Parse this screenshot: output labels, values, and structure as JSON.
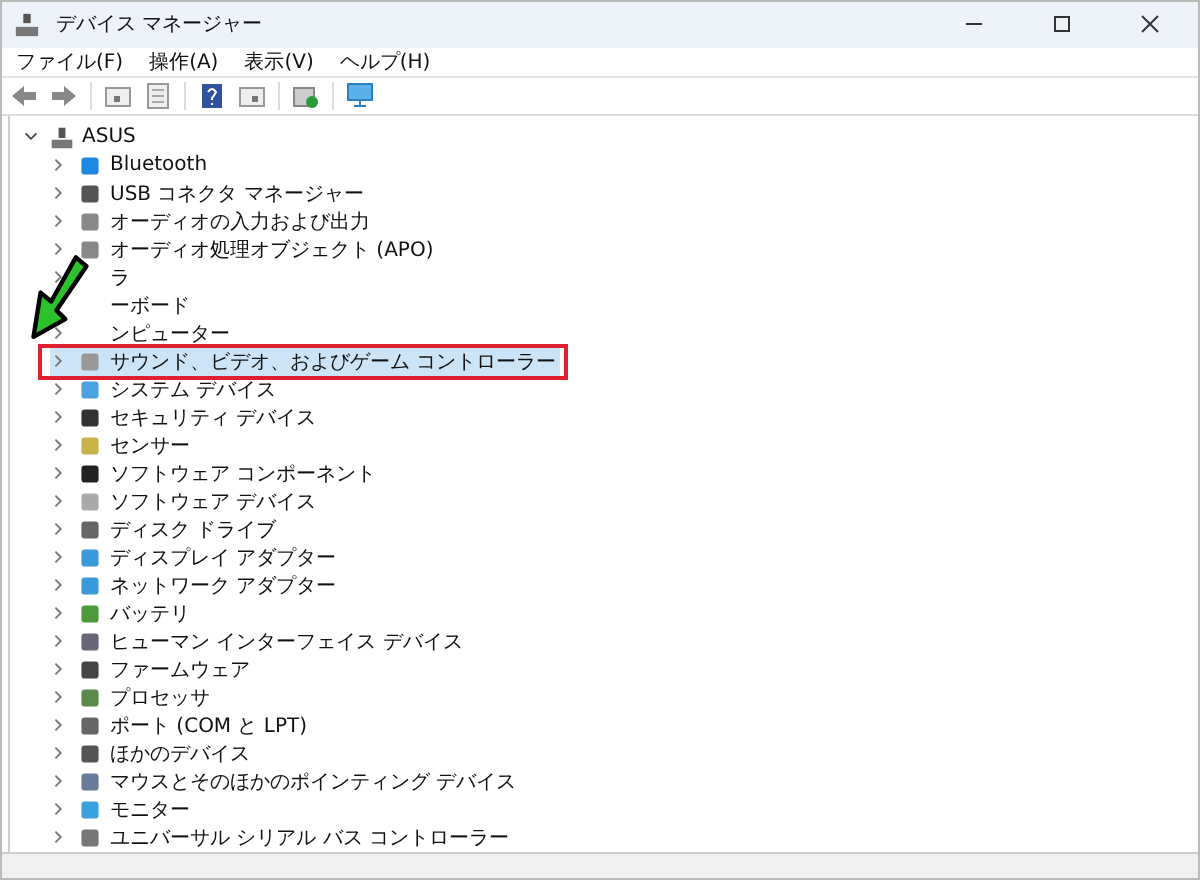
{
  "window": {
    "title": "デバイス マネージャー"
  },
  "menu": [
    "ファイル(F)",
    "操作(A)",
    "表示(V)",
    "ヘルプ(H)"
  ],
  "tree": {
    "label": "ASUS",
    "expanded": true,
    "children": [
      {
        "label": "Bluetooth",
        "selected": false,
        "expanded": false
      },
      {
        "label": "USB コネクタ マネージャー",
        "selected": false,
        "expanded": false
      },
      {
        "label": "オーディオの入力および出力",
        "selected": false,
        "expanded": false
      },
      {
        "label": "オーディオ処理オブジェクト (APO)",
        "selected": false,
        "expanded": false
      },
      {
        "label": "ラ",
        "selected": false,
        "expanded": false
      },
      {
        "label": "ーボード",
        "selected": false
      },
      {
        "label": "ンピューター",
        "selected": false,
        "expanded": false
      },
      {
        "label": "サウンド、ビデオ、およびゲーム コントローラー",
        "selected": true,
        "expanded": false
      },
      {
        "label": "システム デバイス",
        "selected": false,
        "expanded": false
      },
      {
        "label": "セキュリティ デバイス",
        "selected": false,
        "expanded": false
      },
      {
        "label": "センサー",
        "selected": false,
        "expanded": false
      },
      {
        "label": "ソフトウェア コンポーネント",
        "selected": false,
        "expanded": false
      },
      {
        "label": "ソフトウェア デバイス",
        "selected": false,
        "expanded": false
      },
      {
        "label": "ディスク ドライブ",
        "selected": false,
        "expanded": false
      },
      {
        "label": "ディスプレイ アダプター",
        "selected": false,
        "expanded": false
      },
      {
        "label": "ネットワーク アダプター",
        "selected": false,
        "expanded": false
      },
      {
        "label": "バッテリ",
        "selected": false,
        "expanded": false
      },
      {
        "label": "ヒューマン インターフェイス デバイス",
        "selected": false,
        "expanded": false
      },
      {
        "label": "ファームウェア",
        "selected": false,
        "expanded": false
      },
      {
        "label": "プロセッサ",
        "selected": false,
        "expanded": false
      },
      {
        "label": "ポート (COM と LPT)",
        "selected": false,
        "expanded": false
      },
      {
        "label": "ほかのデバイス",
        "selected": false,
        "expanded": false
      },
      {
        "label": "マウスとそのほかのポインティング デバイス",
        "selected": false,
        "expanded": false
      },
      {
        "label": "モニター",
        "selected": false,
        "expanded": false
      },
      {
        "label": "ユニバーサル シリアル バス コントローラー",
        "selected": false,
        "expanded": false
      }
    ]
  }
}
